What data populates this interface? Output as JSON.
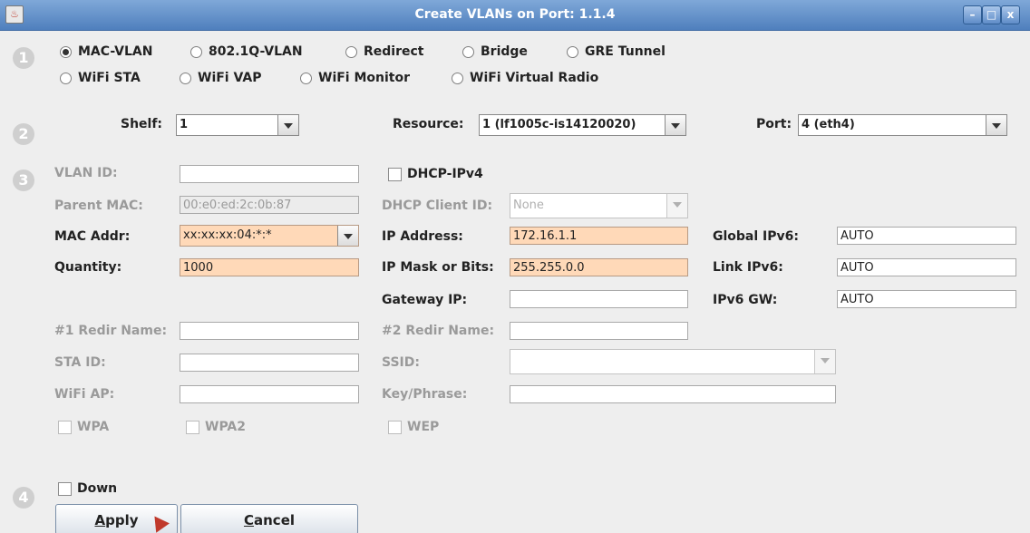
{
  "window": {
    "title": "Create VLANs on Port: 1.1.4",
    "minimize": "–",
    "maximize": "□",
    "close": "x"
  },
  "steps": [
    "1",
    "2",
    "3",
    "4"
  ],
  "types": {
    "selected": "MAC-VLAN",
    "row1": [
      "MAC-VLAN",
      "802.1Q-VLAN",
      "Redirect",
      "Bridge",
      "GRE Tunnel"
    ],
    "row2": [
      "WiFi STA",
      "WiFi VAP",
      "WiFi Monitor",
      "WiFi Virtual Radio"
    ]
  },
  "location": {
    "shelf_label": "Shelf:",
    "shelf_value": "1",
    "resource_label": "Resource:",
    "resource_value": "1 (lf1005c-is14120020)",
    "port_label": "Port:",
    "port_value": "4 (eth4)"
  },
  "form": {
    "vlan_id_label": "VLAN ID:",
    "vlan_id_value": "",
    "parent_mac_label": "Parent MAC:",
    "parent_mac_value": "00:e0:ed:2c:0b:87",
    "mac_addr_label": "MAC Addr:",
    "mac_addr_value": "xx:xx:xx:04:*:*",
    "quantity_label": "Quantity:",
    "quantity_value": "1000",
    "dhcp_ipv4_label": "DHCP-IPv4",
    "dhcp_client_id_label": "DHCP Client ID:",
    "dhcp_client_id_value": "None",
    "ip_address_label": "IP Address:",
    "ip_address_value": "172.16.1.1",
    "ip_mask_label": "IP Mask or Bits:",
    "ip_mask_value": "255.255.0.0",
    "gateway_ip_label": "Gateway IP:",
    "gateway_ip_value": "",
    "global_ipv6_label": "Global IPv6:",
    "global_ipv6_value": "AUTO",
    "link_ipv6_label": "Link IPv6:",
    "link_ipv6_value": "AUTO",
    "ipv6_gw_label": "IPv6 GW:",
    "ipv6_gw_value": "AUTO",
    "redir1_label": "#1 Redir Name:",
    "redir1_value": "",
    "redir2_label": "#2 Redir Name:",
    "redir2_value": "",
    "sta_id_label": "STA ID:",
    "sta_id_value": "",
    "ssid_label": "SSID:",
    "ssid_value": "",
    "wifi_ap_label": "WiFi AP:",
    "wifi_ap_value": "",
    "key_phrase_label": "Key/Phrase:",
    "key_phrase_value": "",
    "wpa_label": "WPA",
    "wpa2_label": "WPA2",
    "wep_label": "WEP"
  },
  "footer": {
    "down_label": "Down",
    "apply_underline": "A",
    "apply_rest": "pply",
    "cancel_underline": "C",
    "cancel_rest": "ancel"
  }
}
